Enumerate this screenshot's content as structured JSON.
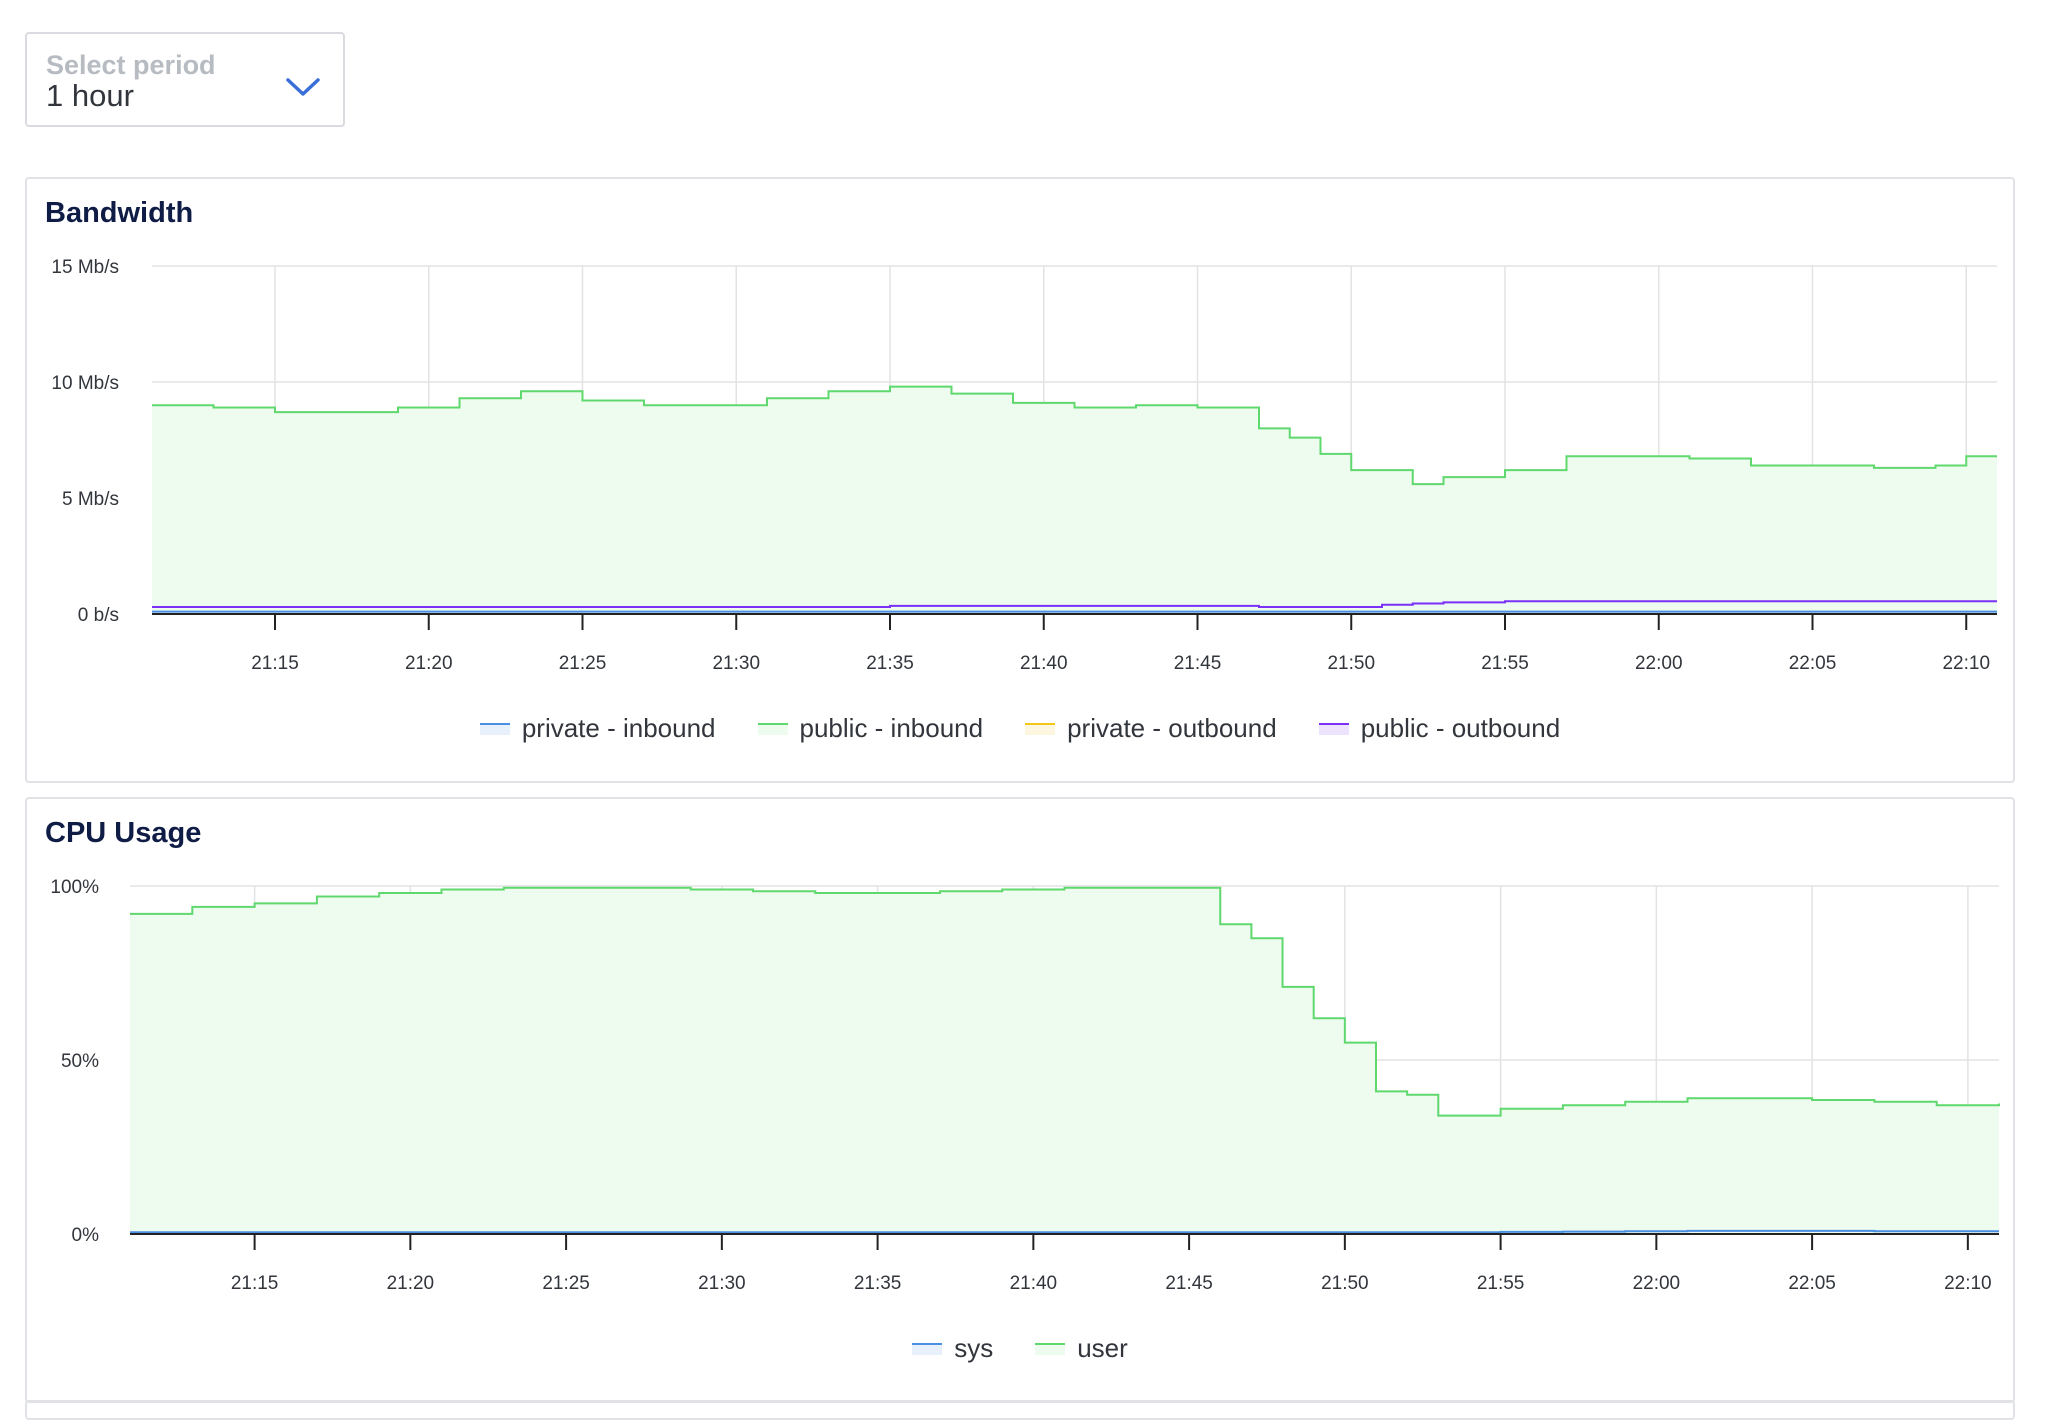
{
  "period_select": {
    "label": "Select period",
    "value": "1 hour",
    "icon": "chevron-down-icon",
    "accent_color": "#3b6fd8"
  },
  "bandwidth": {
    "title": "Bandwidth",
    "chart_data": {
      "type": "area",
      "title": "Bandwidth",
      "xlabel": "",
      "ylabel": "",
      "y_ticks": [
        "15 Mb/s",
        "10 Mb/s",
        "5 Mb/s",
        "0 b/s"
      ],
      "ylim": [
        0,
        15
      ],
      "y_unit": "Mb/s",
      "x_ticks": [
        "21:15",
        "21:20",
        "21:25",
        "21:30",
        "21:35",
        "21:40",
        "21:45",
        "21:50",
        "21:55",
        "22:00",
        "22:05",
        "22:10"
      ],
      "xlim": [
        "21:11",
        "22:11"
      ],
      "grid": true,
      "legend_position": "bottom",
      "x": [
        "21:11",
        "21:13",
        "21:15",
        "21:17",
        "21:19",
        "21:21",
        "21:23",
        "21:25",
        "21:27",
        "21:29",
        "21:31",
        "21:33",
        "21:35",
        "21:37",
        "21:39",
        "21:41",
        "21:43",
        "21:45",
        "21:47",
        "21:48",
        "21:49",
        "21:50",
        "21:51",
        "21:52",
        "21:53",
        "21:55",
        "21:57",
        "21:59",
        "22:01",
        "22:03",
        "22:05",
        "22:07",
        "22:09",
        "22:10",
        "22:11"
      ],
      "series": [
        {
          "name": "private - inbound",
          "color": "#4a90e2",
          "values": [
            0.1,
            0.1,
            0.1,
            0.1,
            0.1,
            0.1,
            0.1,
            0.1,
            0.1,
            0.1,
            0.1,
            0.1,
            0.1,
            0.1,
            0.1,
            0.1,
            0.1,
            0.1,
            0.1,
            0.1,
            0.1,
            0.1,
            0.1,
            0.1,
            0.1,
            0.1,
            0.1,
            0.1,
            0.1,
            0.1,
            0.1,
            0.1,
            0.1,
            0.1,
            0.1
          ]
        },
        {
          "name": "public - inbound",
          "color": "#5fd86d",
          "fill": "#eefbef",
          "values": [
            9.0,
            8.9,
            8.7,
            8.7,
            8.9,
            9.3,
            9.6,
            9.2,
            9.0,
            9.0,
            9.3,
            9.6,
            9.8,
            9.5,
            9.1,
            8.9,
            9.0,
            8.9,
            8.0,
            7.6,
            6.9,
            6.2,
            6.2,
            5.6,
            5.9,
            6.2,
            6.8,
            6.8,
            6.7,
            6.4,
            6.4,
            6.3,
            6.4,
            6.8,
            6.8
          ]
        },
        {
          "name": "private - outbound",
          "color": "#f5c518",
          "values": [
            0.0,
            0.0,
            0.0,
            0.0,
            0.0,
            0.0,
            0.0,
            0.0,
            0.0,
            0.0,
            0.0,
            0.0,
            0.0,
            0.0,
            0.0,
            0.0,
            0.0,
            0.0,
            0.0,
            0.0,
            0.0,
            0.0,
            0.0,
            0.0,
            0.0,
            0.0,
            0.0,
            0.0,
            0.0,
            0.0,
            0.0,
            0.0,
            0.0,
            0.0,
            0.0
          ]
        },
        {
          "name": "public - outbound",
          "color": "#7b2ff7",
          "values": [
            0.3,
            0.3,
            0.3,
            0.3,
            0.3,
            0.3,
            0.3,
            0.3,
            0.3,
            0.3,
            0.3,
            0.3,
            0.35,
            0.35,
            0.35,
            0.35,
            0.35,
            0.35,
            0.3,
            0.3,
            0.3,
            0.3,
            0.4,
            0.45,
            0.5,
            0.55,
            0.55,
            0.55,
            0.55,
            0.55,
            0.55,
            0.55,
            0.55,
            0.55,
            0.55
          ]
        }
      ]
    }
  },
  "cpu": {
    "title": "CPU Usage",
    "chart_data": {
      "type": "area",
      "title": "CPU Usage",
      "xlabel": "",
      "ylabel": "",
      "y_ticks": [
        "100%",
        "50%",
        "0%"
      ],
      "ylim": [
        0,
        100
      ],
      "y_unit": "%",
      "x_ticks": [
        "21:15",
        "21:20",
        "21:25",
        "21:30",
        "21:35",
        "21:40",
        "21:45",
        "21:50",
        "21:55",
        "22:00",
        "22:05",
        "22:10"
      ],
      "xlim": [
        "21:11",
        "22:11"
      ],
      "grid": true,
      "legend_position": "bottom",
      "x": [
        "21:11",
        "21:13",
        "21:15",
        "21:17",
        "21:19",
        "21:21",
        "21:23",
        "21:25",
        "21:27",
        "21:29",
        "21:31",
        "21:33",
        "21:35",
        "21:37",
        "21:39",
        "21:41",
        "21:43",
        "21:45",
        "21:46",
        "21:47",
        "21:48",
        "21:49",
        "21:50",
        "21:51",
        "21:52",
        "21:53",
        "21:54",
        "21:55",
        "21:57",
        "21:59",
        "22:01",
        "22:03",
        "22:05",
        "22:07",
        "22:09",
        "22:11"
      ],
      "series": [
        {
          "name": "sys",
          "color": "#4a90e2",
          "values": [
            0.5,
            0.5,
            0.5,
            0.5,
            0.5,
            0.5,
            0.5,
            0.5,
            0.5,
            0.5,
            0.5,
            0.5,
            0.5,
            0.5,
            0.5,
            0.5,
            0.5,
            0.5,
            0.5,
            0.5,
            0.5,
            0.5,
            0.5,
            0.5,
            0.5,
            0.5,
            0.5,
            0.6,
            0.7,
            0.8,
            0.9,
            0.9,
            0.9,
            0.8,
            0.8,
            0.8
          ]
        },
        {
          "name": "user",
          "color": "#5fd86d",
          "fill": "#eefbef",
          "values": [
            92,
            94,
            95,
            97,
            98,
            99,
            99.5,
            99.5,
            99.5,
            99,
            98.5,
            98,
            98,
            98.5,
            99,
            99.5,
            99.5,
            99.5,
            89,
            85,
            71,
            62,
            55,
            41,
            40,
            34,
            34,
            36,
            37,
            38,
            39,
            39,
            38.5,
            38,
            37,
            37.5
          ]
        }
      ]
    }
  }
}
